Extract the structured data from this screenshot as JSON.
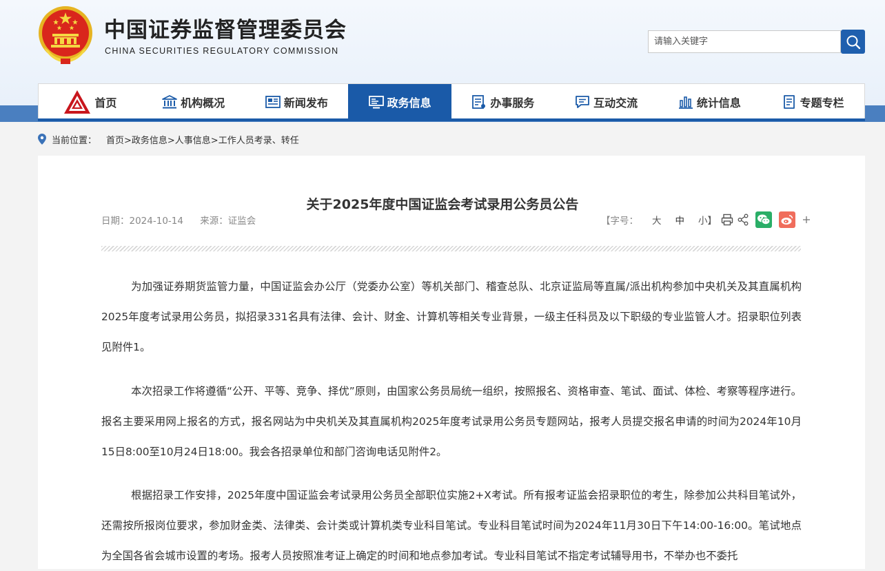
{
  "header": {
    "title": "中国证券监督管理委员会",
    "subtitle": "CHINA SECURITIES REGULATORY COMMISSION",
    "search_placeholder": "请输入关键字"
  },
  "nav": {
    "items": [
      {
        "label": "首页",
        "icon": "csrc-logo-icon"
      },
      {
        "label": "机构概况",
        "icon": "institution-building-icon"
      },
      {
        "label": "新闻发布",
        "icon": "newspaper-icon"
      },
      {
        "label": "政务信息",
        "icon": "monitor-icon",
        "active": true
      },
      {
        "label": "办事服务",
        "icon": "service-document-icon"
      },
      {
        "label": "互动交流",
        "icon": "chat-bubble-icon"
      },
      {
        "label": "统计信息",
        "icon": "bar-chart-icon"
      },
      {
        "label": "专题专栏",
        "icon": "topic-document-icon"
      }
    ],
    "accent": "#1a5aa8"
  },
  "breadcrumb": {
    "label": "当前位置：",
    "path": "首页>政务信息>人事信息>工作人员考录、转任"
  },
  "article": {
    "title": "关于2025年度中国证监会考试录用公务员公告",
    "date": "日期：2024-10-14",
    "source": "来源：证监会",
    "font_label": "【字号：",
    "font_large": "大",
    "font_medium": "中",
    "font_small": "小】",
    "paragraphs": [
      "为加强证券期货监管力量，中国证监会办公厅（党委办公室）等机关部门、稽查总队、北京证监局等直属/派出机构参加中央机关及其直属机构2025年度考试录用公务员，拟招录331名具有法律、会计、财金、计算机等相关专业背景，一级主任科员及以下职级的专业监管人才。招录职位列表见附件1。",
      "本次招录工作将遵循“公开、平等、竞争、择优”原则，由国家公务员局统一组织，按照报名、资格审查、笔试、面试、体检、考察等程序进行。报名主要采用网上报名的方式，报名网站为中央机关及其直属机构2025年度考试录用公务员专题网站，报考人员提交报名申请的时间为2024年10月15日8:00至10月24日18:00。我会各招录单位和部门咨询电话见附件2。",
      "根据招录工作安排，2025年度中国证监会考试录用公务员全部职位实施2+X考试。所有报考证监会招录职位的考生，除参加公共科目笔试外，还需按所报岗位要求，参加财金类、法律类、会计类或计算机类专业科目笔试。专业科目笔试时间为2024年11月30日下午14:00-16:00。笔试地点为全国各省会城市设置的考场。报考人员按照准考证上确定的时间和地点参加考试。专业科目笔试不指定考试辅导用书，不举办也不委托"
    ]
  }
}
